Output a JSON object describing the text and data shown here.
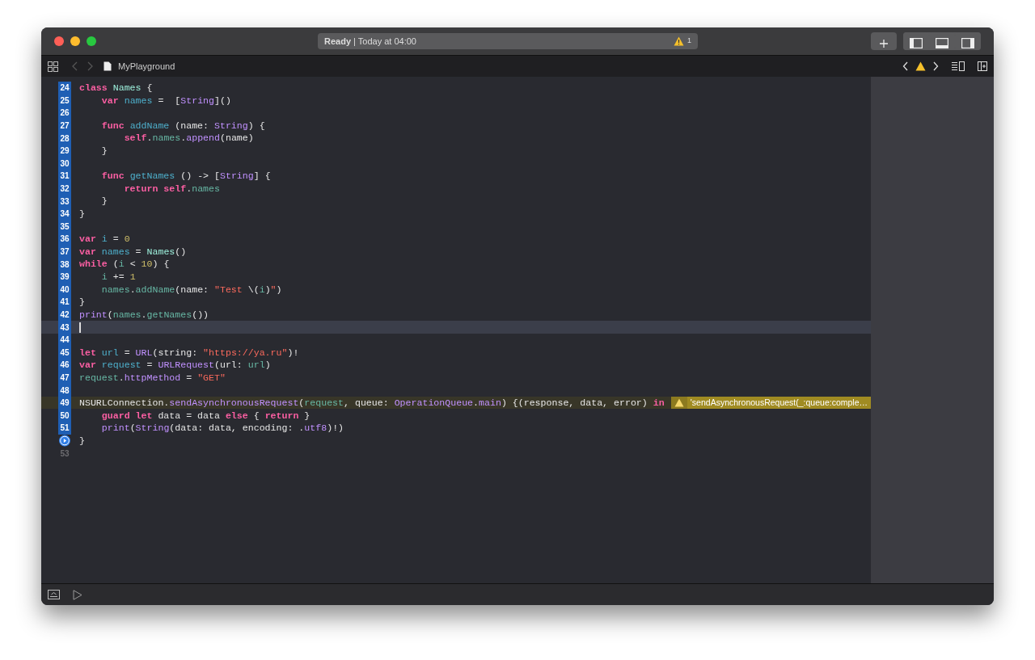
{
  "window": {
    "status": "**Ready** | Today at 04:00",
    "warning_count": "1"
  },
  "navigator": {
    "file": "MyPlayground",
    "back_disabled": true,
    "forward_disabled": true
  },
  "editor": {
    "lines": [
      {
        "number": "24",
        "ran": true,
        "kind": "number",
        "current": false,
        "tokens": [
          {
            "text": "class ",
            "kind": "kw"
          },
          {
            "text": "Names",
            "kind": "type"
          },
          {
            "text": " {",
            "kind": "txt"
          }
        ]
      },
      {
        "number": "25",
        "ran": true,
        "kind": "number",
        "current": false,
        "tokens": [
          {
            "text": "    var ",
            "kind": "kw"
          },
          {
            "text": "names",
            "kind": "decl"
          },
          {
            "text": " =  [",
            "kind": "txt"
          },
          {
            "text": "String",
            "kind": "sys"
          },
          {
            "text": "]()",
            "kind": "txt"
          }
        ]
      },
      {
        "number": "26",
        "ran": true,
        "kind": "number",
        "current": false
      },
      {
        "number": "27",
        "ran": true,
        "kind": "number",
        "current": false,
        "tokens": [
          {
            "text": "    func ",
            "kind": "kw"
          },
          {
            "text": "addName",
            "kind": "decl"
          },
          {
            "text": " (name: ",
            "kind": "txt"
          },
          {
            "text": "String",
            "kind": "sys"
          },
          {
            "text": ") {",
            "kind": "txt"
          }
        ]
      },
      {
        "number": "28",
        "ran": true,
        "kind": "number",
        "current": false,
        "tokens": [
          {
            "text": "        self",
            "kind": "kw"
          },
          {
            "text": ".",
            "kind": "txt"
          },
          {
            "text": "names",
            "kind": "ref"
          },
          {
            "text": ".",
            "kind": "txt"
          },
          {
            "text": "append",
            "kind": "sys"
          },
          {
            "text": "(name)",
            "kind": "txt"
          }
        ]
      },
      {
        "number": "29",
        "ran": true,
        "kind": "number",
        "current": false,
        "tokens": [
          {
            "text": "    }",
            "kind": "txt"
          }
        ]
      },
      {
        "number": "30",
        "ran": true,
        "kind": "number",
        "current": false
      },
      {
        "number": "31",
        "ran": true,
        "kind": "number",
        "current": false,
        "tokens": [
          {
            "text": "    func ",
            "kind": "kw"
          },
          {
            "text": "getNames",
            "kind": "decl"
          },
          {
            "text": " () -> [",
            "kind": "txt"
          },
          {
            "text": "String",
            "kind": "sys"
          },
          {
            "text": "] {",
            "kind": "txt"
          }
        ]
      },
      {
        "number": "32",
        "ran": true,
        "kind": "number",
        "current": false,
        "tokens": [
          {
            "text": "        return self",
            "kind": "kw"
          },
          {
            "text": ".",
            "kind": "txt"
          },
          {
            "text": "names",
            "kind": "ref"
          }
        ]
      },
      {
        "number": "33",
        "ran": true,
        "kind": "number",
        "current": false,
        "tokens": [
          {
            "text": "    }",
            "kind": "txt"
          }
        ]
      },
      {
        "number": "34",
        "ran": true,
        "kind": "number",
        "current": false,
        "tokens": [
          {
            "text": "}",
            "kind": "txt"
          }
        ]
      },
      {
        "number": "35",
        "ran": true,
        "kind": "number",
        "current": false
      },
      {
        "number": "36",
        "ran": true,
        "kind": "number",
        "current": false,
        "tokens": [
          {
            "text": "var ",
            "kind": "kw"
          },
          {
            "text": "i",
            "kind": "decl"
          },
          {
            "text": " = ",
            "kind": "txt"
          },
          {
            "text": "0",
            "kind": "num"
          }
        ]
      },
      {
        "number": "37",
        "ran": true,
        "kind": "number",
        "current": false,
        "tokens": [
          {
            "text": "var ",
            "kind": "kw"
          },
          {
            "text": "names",
            "kind": "decl"
          },
          {
            "text": " = ",
            "kind": "txt"
          },
          {
            "text": "Names",
            "kind": "type"
          },
          {
            "text": "()",
            "kind": "txt"
          }
        ]
      },
      {
        "number": "38",
        "ran": true,
        "kind": "number",
        "current": false,
        "tokens": [
          {
            "text": "while",
            "kind": "kw"
          },
          {
            "text": " (",
            "kind": "txt"
          },
          {
            "text": "i",
            "kind": "ref"
          },
          {
            "text": " < ",
            "kind": "txt"
          },
          {
            "text": "10",
            "kind": "num"
          },
          {
            "text": ") {",
            "kind": "txt"
          }
        ]
      },
      {
        "number": "39",
        "ran": true,
        "kind": "number",
        "current": false,
        "tokens": [
          {
            "text": "    i",
            "kind": "ref"
          },
          {
            "text": " += ",
            "kind": "txt"
          },
          {
            "text": "1",
            "kind": "num"
          }
        ]
      },
      {
        "number": "40",
        "ran": true,
        "kind": "number",
        "current": false,
        "tokens": [
          {
            "text": "    names",
            "kind": "ref"
          },
          {
            "text": ".",
            "kind": "txt"
          },
          {
            "text": "addName",
            "kind": "ref"
          },
          {
            "text": "(name: ",
            "kind": "txt"
          },
          {
            "text": "\"Test ",
            "kind": "str"
          },
          {
            "text": "\\(",
            "kind": "txt"
          },
          {
            "text": "i",
            "kind": "ref"
          },
          {
            "text": ")",
            "kind": "txt"
          },
          {
            "text": "\"",
            "kind": "str"
          },
          {
            "text": ")",
            "kind": "txt"
          }
        ]
      },
      {
        "number": "41",
        "ran": true,
        "kind": "number",
        "current": false,
        "tokens": [
          {
            "text": "}",
            "kind": "txt"
          }
        ]
      },
      {
        "number": "42",
        "ran": true,
        "kind": "number",
        "current": false,
        "tokens": [
          {
            "text": "print",
            "kind": "sys"
          },
          {
            "text": "(",
            "kind": "txt"
          },
          {
            "text": "names",
            "kind": "ref"
          },
          {
            "text": ".",
            "kind": "txt"
          },
          {
            "text": "getNames",
            "kind": "ref"
          },
          {
            "text": "())",
            "kind": "txt"
          }
        ]
      },
      {
        "number": "43",
        "ran": true,
        "kind": "number",
        "current": true
      },
      {
        "number": "44",
        "ran": true,
        "kind": "number",
        "current": false
      },
      {
        "number": "45",
        "ran": true,
        "kind": "number",
        "current": false,
        "tokens": [
          {
            "text": "let ",
            "kind": "kw"
          },
          {
            "text": "url",
            "kind": "decl"
          },
          {
            "text": " = ",
            "kind": "txt"
          },
          {
            "text": "URL",
            "kind": "sys"
          },
          {
            "text": "(string: ",
            "kind": "txt"
          },
          {
            "text": "\"https://ya.ru\"",
            "kind": "str"
          },
          {
            "text": ")!",
            "kind": "txt"
          }
        ]
      },
      {
        "number": "46",
        "ran": true,
        "kind": "number",
        "current": false,
        "tokens": [
          {
            "text": "var ",
            "kind": "kw"
          },
          {
            "text": "request",
            "kind": "decl"
          },
          {
            "text": " = ",
            "kind": "txt"
          },
          {
            "text": "URLRequest",
            "kind": "sys"
          },
          {
            "text": "(url: ",
            "kind": "txt"
          },
          {
            "text": "url",
            "kind": "ref"
          },
          {
            "text": ")",
            "kind": "txt"
          }
        ]
      },
      {
        "number": "47",
        "ran": true,
        "kind": "number",
        "current": false,
        "tokens": [
          {
            "text": "request",
            "kind": "ref"
          },
          {
            "text": ".",
            "kind": "txt"
          },
          {
            "text": "httpMethod",
            "kind": "sys"
          },
          {
            "text": " = ",
            "kind": "txt"
          },
          {
            "text": "\"GET\"",
            "kind": "str"
          }
        ]
      },
      {
        "number": "48",
        "ran": true,
        "kind": "number",
        "current": false
      },
      {
        "number": "49",
        "ran": true,
        "kind": "number",
        "current": false,
        "warning": "'sendAsynchronousRequest(_:queue:comple…",
        "tokens": [
          {
            "text": "NSURLConnection.",
            "kind": "txt"
          },
          {
            "text": "sendAsynchronousRequest",
            "kind": "sys"
          },
          {
            "text": "(",
            "kind": "txt"
          },
          {
            "text": "request",
            "kind": "ref"
          },
          {
            "text": ", queue: ",
            "kind": "txt"
          },
          {
            "text": "OperationQueue",
            "kind": "sys"
          },
          {
            "text": ".",
            "kind": "txt"
          },
          {
            "text": "main",
            "kind": "sys"
          },
          {
            "text": ") {(response, data, error) ",
            "kind": "txt"
          },
          {
            "text": "in",
            "kind": "kw"
          }
        ]
      },
      {
        "number": "50",
        "ran": true,
        "kind": "number",
        "current": false,
        "tokens": [
          {
            "text": "    guard let ",
            "kind": "kw"
          },
          {
            "text": "data = data ",
            "kind": "txt"
          },
          {
            "text": "else",
            "kind": "kw"
          },
          {
            "text": " { ",
            "kind": "txt"
          },
          {
            "text": "return",
            "kind": "kw"
          },
          {
            "text": " }",
            "kind": "txt"
          }
        ]
      },
      {
        "number": "51",
        "ran": true,
        "kind": "number",
        "current": false,
        "tokens": [
          {
            "text": "    print",
            "kind": "sys"
          },
          {
            "text": "(",
            "kind": "txt"
          },
          {
            "text": "String",
            "kind": "sys"
          },
          {
            "text": "(data: data, encoding: .",
            "kind": "txt"
          },
          {
            "text": "utf8",
            "kind": "sys"
          },
          {
            "text": ")!)",
            "kind": "txt"
          }
        ]
      },
      {
        "kind": "run",
        "current": false,
        "tokens": [
          {
            "text": "}",
            "kind": "txt"
          }
        ]
      },
      {
        "number": "53",
        "ran": false,
        "kind": "number",
        "current": false
      }
    ]
  }
}
